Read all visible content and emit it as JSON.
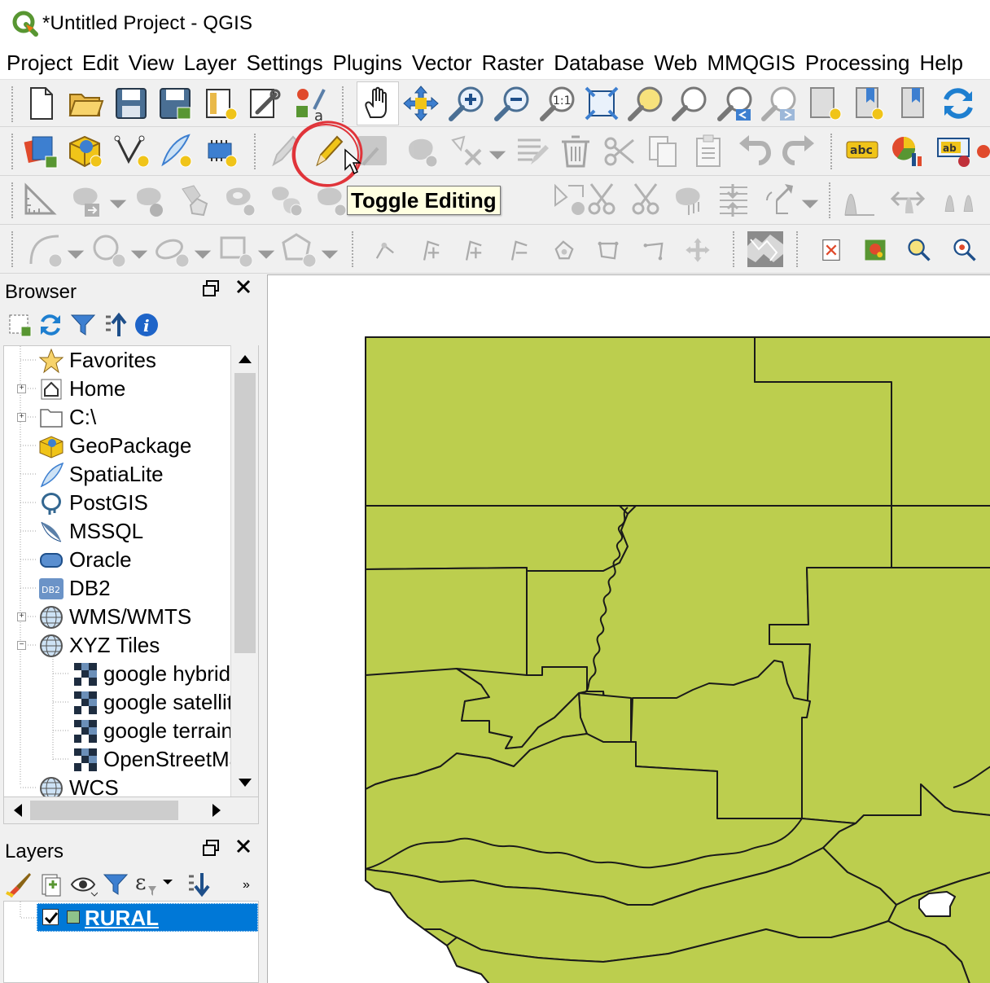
{
  "window": {
    "title": "*Untitled Project - QGIS"
  },
  "menu": [
    "Project",
    "Edit",
    "View",
    "Layer",
    "Settings",
    "Plugins",
    "Vector",
    "Raster",
    "Database",
    "Web",
    "MMQGIS",
    "Processing",
    "Help"
  ],
  "tooltip": {
    "text": "Toggle Editing"
  },
  "browser": {
    "title": "Browser",
    "items": [
      {
        "label": "Favorites",
        "icon": "star-icon"
      },
      {
        "label": "Home",
        "icon": "home-icon"
      },
      {
        "label": "C:\\",
        "icon": "folder-icon"
      },
      {
        "label": "GeoPackage",
        "icon": "geopackage-icon"
      },
      {
        "label": "SpatiaLite",
        "icon": "spatialite-icon"
      },
      {
        "label": "PostGIS",
        "icon": "postgis-icon"
      },
      {
        "label": "MSSQL",
        "icon": "mssql-icon"
      },
      {
        "label": "Oracle",
        "icon": "oracle-icon"
      },
      {
        "label": "DB2",
        "icon": "db2-icon"
      },
      {
        "label": "WMS/WMTS",
        "icon": "globe-icon"
      },
      {
        "label": "XYZ Tiles",
        "icon": "globe-icon"
      },
      {
        "label": "google hybrid",
        "icon": "tiles-icon"
      },
      {
        "label": "google satellite",
        "icon": "tiles-icon"
      },
      {
        "label": "google terrain",
        "icon": "tiles-icon"
      },
      {
        "label": "OpenStreetMap",
        "icon": "tiles-icon"
      },
      {
        "label": "WCS",
        "icon": "globe-icon"
      }
    ],
    "db2_badge": "DB2"
  },
  "layers": {
    "title": "Layers",
    "items": [
      {
        "label": "RURAL",
        "checked": true,
        "color": "#8fc28b"
      }
    ]
  },
  "icons": {
    "abc_label": "abc",
    "ab_label": "ab",
    "zoom_native": "1:1",
    "text_tool_letter": "a"
  },
  "colors": {
    "map_fill": "#bcce4e",
    "selection": "#0078d7",
    "annotation": "#e0343a"
  }
}
